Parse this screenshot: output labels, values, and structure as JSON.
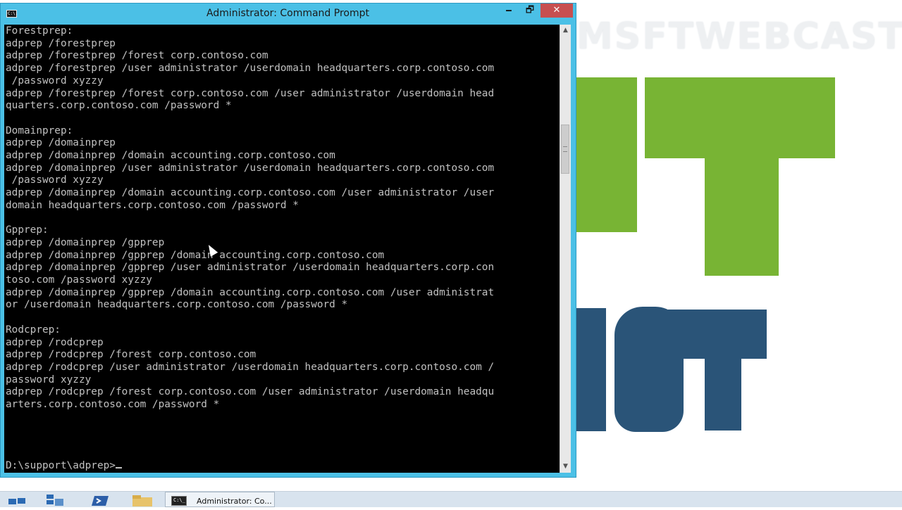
{
  "window": {
    "title": "Administrator: Command Prompt",
    "app_icon_text": "C:\\.",
    "minimize_glyph": "🗕",
    "maximize_glyph": "🗗",
    "close_glyph": "✕"
  },
  "console": {
    "lines": [
      "Forestprep:",
      "adprep /forestprep",
      "adprep /forestprep /forest corp.contoso.com",
      "adprep /forestprep /user administrator /userdomain headquarters.corp.contoso.com",
      " /password xyzzy",
      "adprep /forestprep /forest corp.contoso.com /user administrator /userdomain head",
      "quarters.corp.contoso.com /password *",
      "",
      "Domainprep:",
      "adprep /domainprep",
      "adprep /domainprep /domain accounting.corp.contoso.com",
      "adprep /domainprep /user administrator /userdomain headquarters.corp.contoso.com",
      " /password xyzzy",
      "adprep /domainprep /domain accounting.corp.contoso.com /user administrator /user",
      "domain headquarters.corp.contoso.com /password *",
      "",
      "Gpprep:",
      "adprep /domainprep /gpprep",
      "adprep /domainprep /gpprep /domain accounting.corp.contoso.com",
      "adprep /domainprep /gpprep /user administrator /userdomain headquarters.corp.con",
      "toso.com /password xyzzy",
      "adprep /domainprep /gpprep /domain accounting.corp.contoso.com /user administrat",
      "or /userdomain headquarters.corp.contoso.com /password *",
      "",
      "Rodcprep:",
      "adprep /rodcprep",
      "adprep /rodcprep /forest corp.contoso.com",
      "adprep /rodcprep /user administrator /userdomain headquarters.corp.contoso.com /",
      "password xyzzy",
      "adprep /rodcprep /forest corp.contoso.com /user administrator /userdomain headqu",
      "arters.corp.contoso.com /password *"
    ],
    "prompt": "D:\\support\\adprep>"
  },
  "desktop": {
    "watermark": "MSFTWEBCAST",
    "colors": {
      "logo_green": "#78b434",
      "logo_blue": "#2a5478",
      "title_bar": "#4bc0e6",
      "close_button": "#c74f50"
    }
  },
  "taskbar": {
    "items": [
      {
        "name": "start-icon"
      },
      {
        "name": "server-manager-icon"
      },
      {
        "name": "powershell-icon"
      },
      {
        "name": "file-explorer-icon"
      }
    ],
    "cmd_task_label": "Administrator: Co...",
    "cmd_task_icon_text": "C:\\_"
  }
}
